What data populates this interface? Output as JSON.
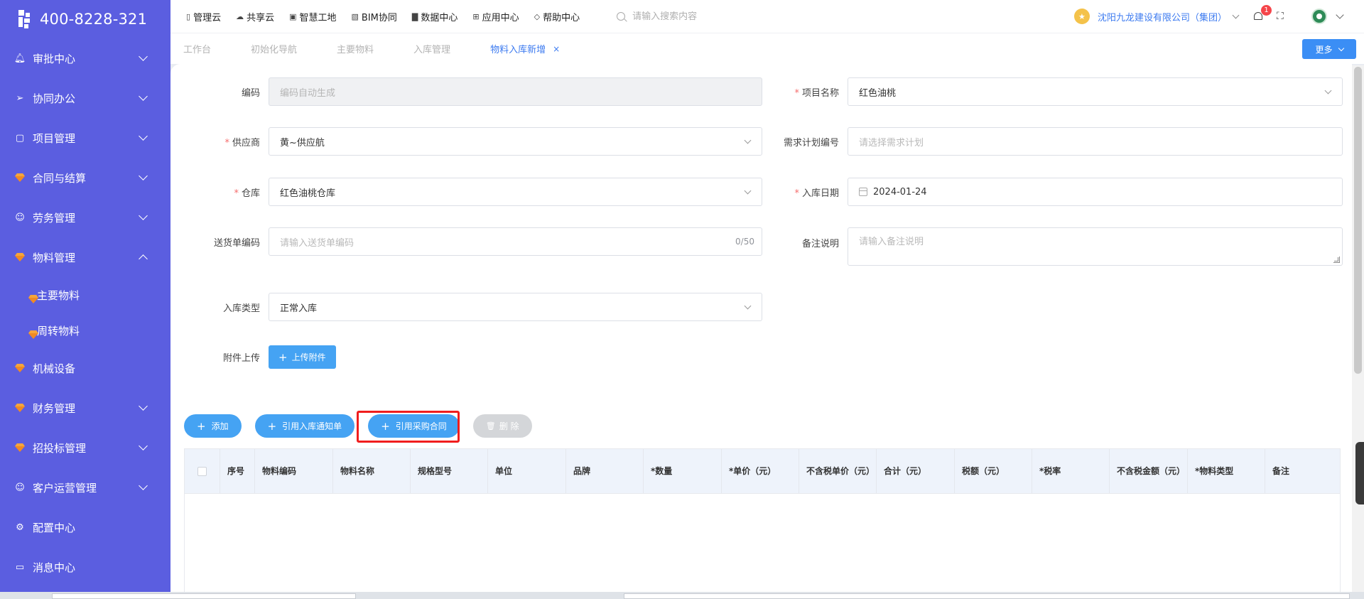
{
  "sidebar": {
    "phone": "400-8228-321",
    "items": [
      {
        "label": "审批中心",
        "icon": "bell-icon",
        "expandable": true
      },
      {
        "label": "协同办公",
        "icon": "send-icon",
        "expandable": true
      },
      {
        "label": "项目管理",
        "icon": "book-icon",
        "expandable": true
      },
      {
        "label": "合同与结算",
        "icon": "gem-icon",
        "expandable": true
      },
      {
        "label": "劳务管理",
        "icon": "user-icon",
        "expandable": true
      },
      {
        "label": "物料管理",
        "icon": "gem-icon",
        "expandable": true,
        "expanded": true
      },
      {
        "label": "机械设备",
        "icon": "gem-icon",
        "expandable": false
      },
      {
        "label": "财务管理",
        "icon": "gem-icon",
        "expandable": true
      },
      {
        "label": "招投标管理",
        "icon": "gem-icon",
        "expandable": true
      },
      {
        "label": "客户运营管理",
        "icon": "user-icon",
        "expandable": true
      },
      {
        "label": "配置中心",
        "icon": "gear-icon",
        "expandable": false
      },
      {
        "label": "消息中心",
        "icon": "message-icon",
        "expandable": false
      }
    ],
    "subitems": [
      "主要物料",
      "周转物料"
    ]
  },
  "topnav": [
    "管理云",
    "共享云",
    "智慧工地",
    "BIM协同",
    "数据中心",
    "应用中心",
    "帮助中心"
  ],
  "search": {
    "placeholder": "请输入搜索内容"
  },
  "company": "沈阳九龙建设有限公司（集团）",
  "notification_count": "1",
  "tabs": [
    "工作台",
    "初始化导航",
    "主要物料",
    "入库管理",
    "物料入库新增"
  ],
  "tab_close": "×",
  "more_label": "更多",
  "form": {
    "code_label": "编码",
    "code_value": "编码自动生成",
    "project_label": "项目名称",
    "project_value": "红色油桃",
    "supplier_label": "供应商",
    "supplier_value": "黄~供应航",
    "plan_label": "需求计划编号",
    "plan_placeholder": "请选择需求计划",
    "warehouse_label": "仓库",
    "warehouse_value": "红色油桃仓库",
    "date_label": "入库日期",
    "date_value": "2024-01-24",
    "delivery_label": "送货单编码",
    "delivery_placeholder": "请输入送货单编码",
    "delivery_count": "0/50",
    "remark_label": "备注说明",
    "remark_placeholder": "请输入备注说明",
    "type_label": "入库类型",
    "type_value": "正常入库",
    "attach_label": "附件上传",
    "upload_label": "上传附件"
  },
  "actions": {
    "add": "添加",
    "cite_notice": "引用入库通知单",
    "cite_contract": "引用采购合同",
    "delete": "删 除"
  },
  "table": {
    "headers": [
      "序号",
      "物料编码",
      "物料名称",
      "规格型号",
      "单位",
      "品牌",
      "*数量",
      "*单价（元）",
      "不含税单价（元）",
      "合计（元）",
      "税额（元）",
      "*税率",
      "不含税金额（元）",
      "*物料类型",
      "备注"
    ]
  }
}
